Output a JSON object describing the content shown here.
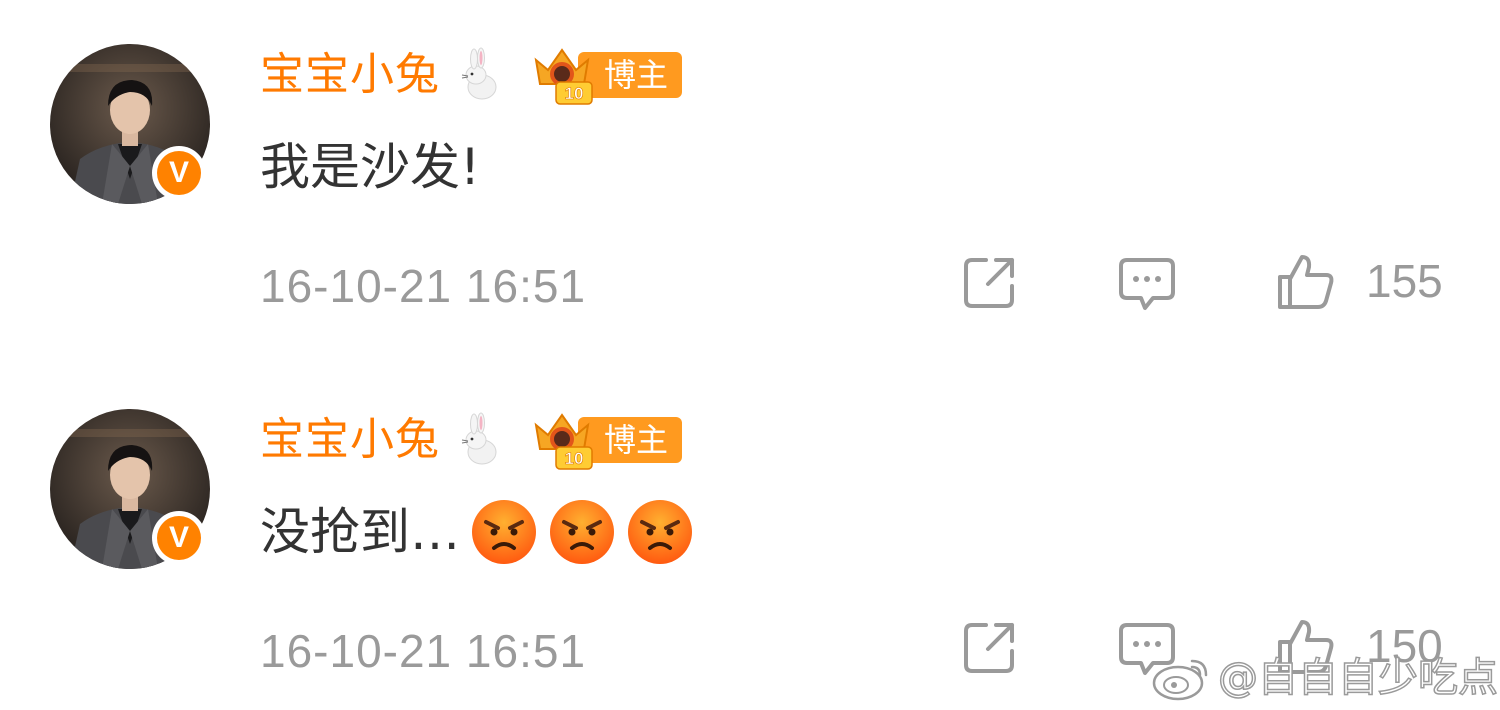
{
  "comments": [
    {
      "username": "宝宝小兔",
      "rank_label": "博主",
      "rank_level": "10",
      "text": "我是沙发!",
      "emojis": [],
      "timestamp": "16-10-21 16:51",
      "like_count": "155",
      "icons": {
        "avatar": "avatar-photo",
        "verified": "verified-v-icon",
        "rabbit": "rabbit-icon",
        "rank": "crown-rank-icon",
        "share": "share-icon",
        "reply": "comment-icon",
        "like": "thumbs-up-icon"
      }
    },
    {
      "username": "宝宝小兔",
      "rank_label": "博主",
      "rank_level": "10",
      "text": "没抢到…",
      "emojis": [
        "angry-face-emoji",
        "angry-face-emoji",
        "angry-face-emoji"
      ],
      "timestamp": "16-10-21 16:51",
      "like_count": "150",
      "icons": {
        "avatar": "avatar-photo",
        "verified": "verified-v-icon",
        "rabbit": "rabbit-icon",
        "rank": "crown-rank-icon",
        "share": "share-icon",
        "reply": "comment-icon",
        "like": "thumbs-up-icon"
      }
    }
  ],
  "verified_glyph": "V",
  "watermark": {
    "text": "@自自自少吃点",
    "icon": "weibo-logo-icon"
  },
  "colors": {
    "username": "#ff7a00",
    "verified": "#ff8200",
    "rank_badge": "#ff9a1f",
    "text": "#333333",
    "meta": "#9a9a9a"
  }
}
